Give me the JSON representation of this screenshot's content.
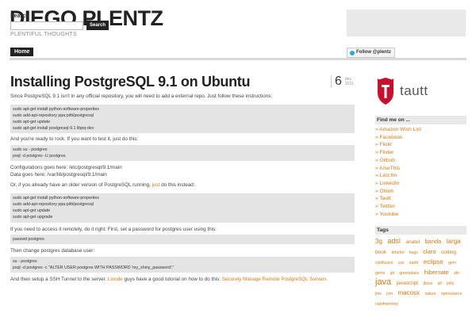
{
  "site": {
    "title": "DIEGO PLENTZ",
    "tagline": "PLENTIFUL THOUGHTS"
  },
  "search": {
    "label": "Search",
    "placeholder": "",
    "button": "Search"
  },
  "nav": {
    "home": "Home"
  },
  "follow": {
    "label": "Follow @plentz"
  },
  "post": {
    "title": "Installing PostgreSQL 9.1 on Ubuntu",
    "day": "6",
    "month": "dec",
    "year": "2011",
    "intro": "Since PostgreSQL 9.1 isn't in any official repository, you will need to add a external repo. Just follow these instructions:",
    "code1": [
      "sudo apt-get install python-software-properties",
      "sudo add-apt-repository ppa:pitti/postgresql",
      "sudo apt-get update",
      "sudo apt-get install postgresql-9.1 libpq-dev"
    ],
    "ready": "And you're ready to rock. If you want to test it, just do this:",
    "code2": [
      "sudo su - postgres",
      "psql -d postgres -U postgres"
    ],
    "config1": "Configurations goes here: /etc/postgresql/9.1/main",
    "config2": "Data goes here: /var/lib/postgresql/9.1/main",
    "older_pre": "Or, if you already have an older version of PostgreSQL running, ",
    "older_link": "just",
    "older_post": " do this instead:",
    "code3": [
      "sudo apt-get install python-software-properties",
      "sudo add-apt-repository ppa:pitti/postgresql",
      "sudo apt-get update",
      "sudo apt-get upgrade"
    ],
    "remote": "If you need to access it remotely, do it right: First, set a password for postgres user using this:",
    "code4": [
      "passwd postgres"
    ],
    "change": "Then change postgres database user:",
    "code5": [
      "su - postgres",
      "psql -d postgres -c \"ALTER USER postgres WITH PASSWORD 'my_shiny_password';\""
    ],
    "tunnel_pre": "And then setup a SSH Tunnel to the server. ",
    "tunnel_link1": "Linode",
    "tunnel_mid": " guys have a good tutorial on how to do this: ",
    "tunnel_link2": "Securely Manage Remote PostgreSQL Servers"
  },
  "sidebar": {
    "logo_word": "tautt",
    "find_me_title": "Find me on ...",
    "find_me": [
      "Amazon Wish List",
      "Facebook",
      "Flickr",
      "Flixter",
      "Github",
      "iUseThis",
      "Last.fm",
      "LinkedIn",
      "Ohloh",
      "Tautt",
      "Twitter",
      "Youtube"
    ],
    "tags_title": "Tags",
    "tags": [
      {
        "t": "3g",
        "s": 8
      },
      {
        "t": "adsl",
        "s": 9
      },
      {
        "t": "anatel",
        "s": 6.5
      },
      {
        "t": "banda",
        "s": 7.5
      },
      {
        "t": "larga",
        "s": 8
      },
      {
        "t": "book",
        "s": 6.5
      },
      {
        "t": "brturbo",
        "s": 5
      },
      {
        "t": "bugs",
        "s": 5
      },
      {
        "t": "claro",
        "s": 7.5
      },
      {
        "t": "coding",
        "s": 6.5
      },
      {
        "t": "coldfusion",
        "s": 5
      },
      {
        "t": "css",
        "s": 5
      },
      {
        "t": "earth",
        "s": 5
      },
      {
        "t": "eclipse",
        "s": 8
      },
      {
        "t": "gem",
        "s": 5
      },
      {
        "t": "gems",
        "s": 5
      },
      {
        "t": "git",
        "s": 5
      },
      {
        "t": "greenplace",
        "s": 5
      },
      {
        "t": "hibernate",
        "s": 7.5
      },
      {
        "t": "ide",
        "s": 5
      },
      {
        "t": "java",
        "s": 11
      },
      {
        "t": "javascript",
        "s": 6.5
      },
      {
        "t": "jboss",
        "s": 5
      },
      {
        "t": "jsf",
        "s": 5
      },
      {
        "t": "jetty",
        "s": 5
      },
      {
        "t": "jms",
        "s": 5
      },
      {
        "t": "jvm",
        "s": 5
      },
      {
        "t": "macosx",
        "s": 8
      },
      {
        "t": "nature",
        "s": 5
      },
      {
        "t": "opensource",
        "s": 5
      },
      {
        "t": "outofmemory",
        "s": 5
      }
    ]
  }
}
